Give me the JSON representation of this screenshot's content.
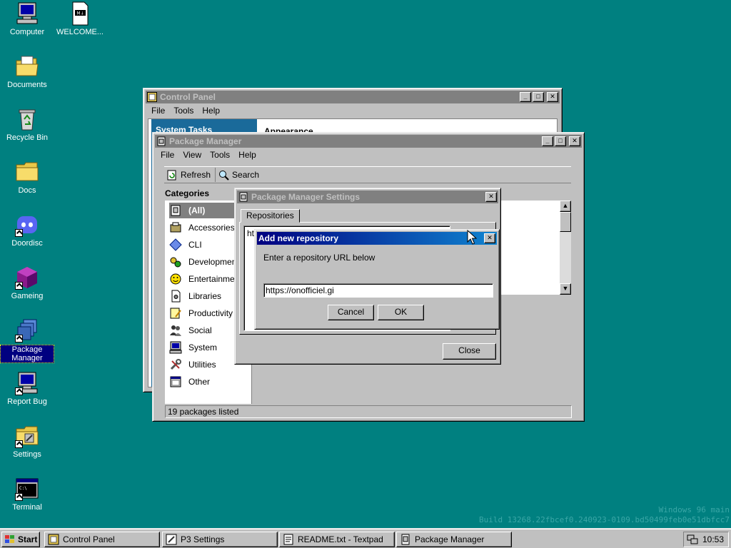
{
  "desktop": {
    "icons": [
      {
        "label": "Computer",
        "icon": "computer-icon"
      },
      {
        "label": "WELCOME...",
        "icon": "markdown-file-icon"
      },
      {
        "label": "Documents",
        "icon": "documents-folder-icon"
      },
      {
        "label": "Recycle Bin",
        "icon": "recycle-bin-icon"
      },
      {
        "label": "Docs",
        "icon": "folder-icon"
      },
      {
        "label": "Doordisc",
        "icon": "discord-icon"
      },
      {
        "label": "Gameing",
        "icon": "cube-icon"
      },
      {
        "label": "Package Manager",
        "icon": "package-manager-icon"
      },
      {
        "label": "Report Bug",
        "icon": "report-bug-icon"
      },
      {
        "label": "Settings",
        "icon": "settings-folder-icon"
      },
      {
        "label": "Terminal",
        "icon": "terminal-icon"
      }
    ],
    "watermark_line1": "Windows 96 main",
    "watermark_line2": "Build 13268.22fbcef0.240923-0109.bd50499feb0e51dbfcc7"
  },
  "control_panel": {
    "title": "Control Panel",
    "menu": [
      "File",
      "Tools",
      "Help"
    ],
    "side_heading": "System Tasks",
    "section_heading": "Appearance"
  },
  "package_manager": {
    "title": "Package Manager",
    "menu": [
      "File",
      "View",
      "Tools",
      "Help"
    ],
    "toolbar": {
      "refresh": "Refresh",
      "search": "Search"
    },
    "categories_heading": "Categories",
    "categories": [
      "(All)",
      "Accessories",
      "CLI",
      "Development",
      "Entertainment",
      "Libraries",
      "Productivity",
      "Social",
      "System",
      "Utilities",
      "Other"
    ],
    "status": "19 packages listed"
  },
  "settings_dialog": {
    "title": "Package Manager Settings",
    "tab": "Repositories",
    "repo_entry": "htt",
    "close_label": "Close"
  },
  "add_repo_dialog": {
    "title": "Add new repository",
    "prompt": "Enter a repository URL below",
    "url_value": "https://onofficiel.gi",
    "cancel_label": "Cancel",
    "ok_label": "OK"
  },
  "taskbar": {
    "start_label": "Start",
    "items": [
      "Control Panel",
      "P3 Settings",
      "README.txt - Textpad",
      "Package Manager"
    ],
    "clock": "10:53"
  },
  "colors": {
    "desktop": "#008080",
    "title_active": "#000080",
    "title_inactive": "#808080",
    "selection": "#000080"
  }
}
